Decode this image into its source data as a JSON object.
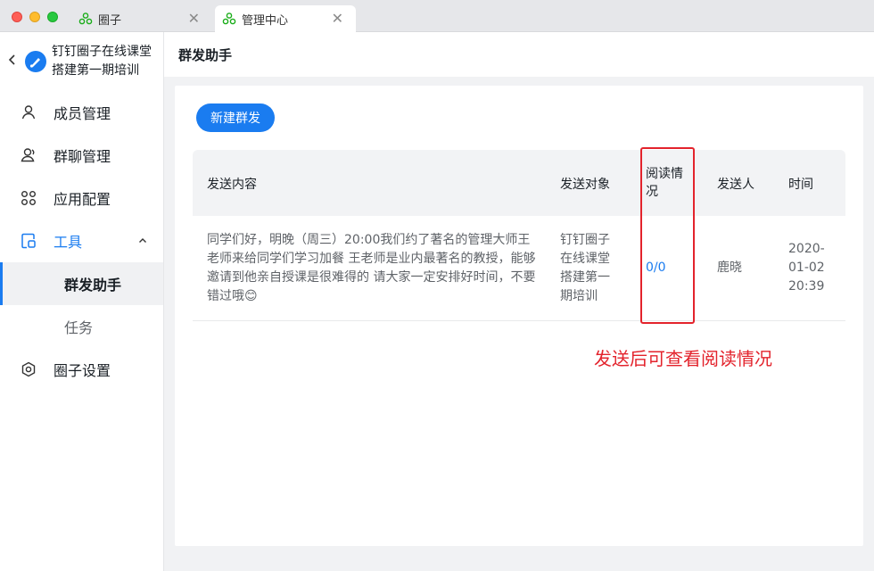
{
  "window": {
    "tabs": [
      {
        "label": "圈子",
        "icon": "circle-group-icon",
        "close": "✕"
      },
      {
        "label": "管理中心",
        "icon": "circle-group-icon",
        "close": "✕"
      }
    ],
    "icon_color": "#1aad19"
  },
  "sidebar": {
    "org_name": "钉钉圈子在线课堂搭建第一期培训",
    "items": [
      {
        "label": "成员管理",
        "icon": "member-icon"
      },
      {
        "label": "群聊管理",
        "icon": "group-chat-icon"
      },
      {
        "label": "应用配置",
        "icon": "app-config-icon"
      },
      {
        "label": "工具",
        "icon": "tools-icon",
        "expanded": true
      },
      {
        "label": "群发助手",
        "active": true
      },
      {
        "label": "任务"
      },
      {
        "label": "圈子设置",
        "icon": "settings-icon"
      }
    ]
  },
  "header": {
    "title": "群发助手"
  },
  "main": {
    "new_button": "新建群发",
    "table": {
      "columns": [
        "发送内容",
        "发送对象",
        "阅读情况",
        "发送人",
        "时间"
      ],
      "rows": [
        {
          "content": "同学们好，明晚（周三）20:00我们约了著名的管理大师王老师来给同学们学习加餐 王老师是业内最著名的教授，能够邀请到他亲自授课是很难得的 请大家一定安排好时间，不要错过哦😊",
          "target": "钉钉圈子在线课堂搭建第一期培训",
          "read": "0/0",
          "sender": "鹿晓",
          "time": "2020-01-02 20:39"
        }
      ]
    },
    "annotation": "发送后可查看阅读情况"
  },
  "colors": {
    "accent": "#1a7cf0",
    "highlight": "#e3232c"
  }
}
